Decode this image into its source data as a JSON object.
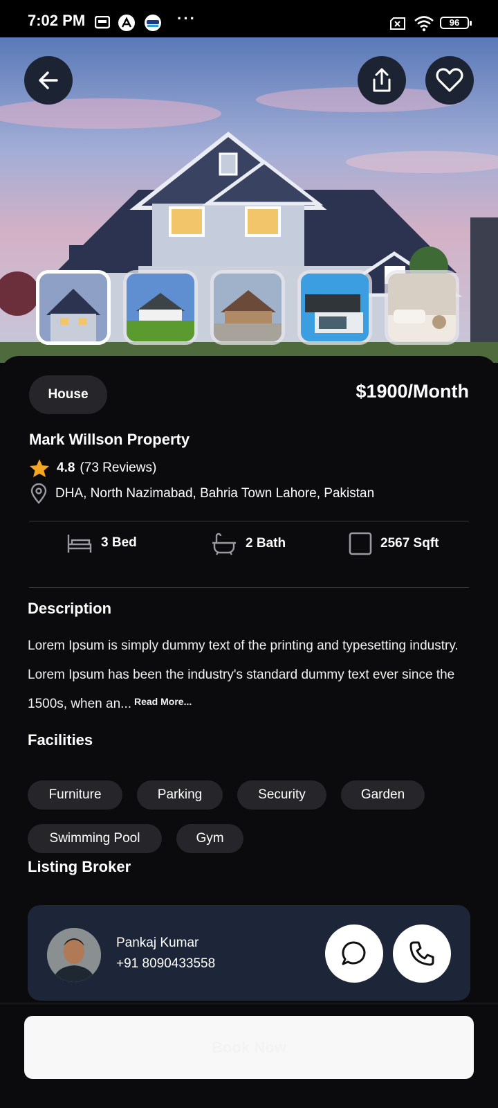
{
  "status_bar": {
    "time": "7:02 PM",
    "battery": "96",
    "icons": [
      "notification-icon",
      "app-icon",
      "cricket-icon",
      "more-dots",
      "sim-icon",
      "wifi-icon",
      "battery-icon"
    ]
  },
  "hero": {
    "actions": [
      "back-arrow-icon",
      "share-icon",
      "heart-icon"
    ],
    "thumbnails": [
      {
        "name": "thumb-house-evening",
        "active": true
      },
      {
        "name": "thumb-house-lawn",
        "active": false
      },
      {
        "name": "thumb-house-stone",
        "active": false
      },
      {
        "name": "thumb-modern-house",
        "active": false
      },
      {
        "name": "thumb-interior",
        "active": false
      }
    ]
  },
  "property": {
    "type": "House",
    "price": "$1900/Month",
    "title": "Mark Willson Property",
    "rating": "4.8",
    "reviews": "(73 Reviews)",
    "location": "DHA, North Nazimabad, Bahria Town Lahore, Pakistan"
  },
  "specs": {
    "beds": "3 Bed",
    "baths": "2 Bath",
    "area": "2567 Sqft"
  },
  "description": {
    "title": "Description",
    "text": "Lorem Ipsum is simply dummy text of the printing and typesetting industry. Lorem Ipsum has been the industry's standard dummy text ever since the 1500s, when an...",
    "read_more": "Read More..."
  },
  "facilities": {
    "title": "Facilities",
    "items": [
      "Furniture",
      "Parking",
      "Security",
      "Garden",
      "Swimming Pool",
      "Gym"
    ]
  },
  "broker": {
    "section_title": "Listing Broker",
    "name": "Pankaj Kumar",
    "phone": "+91 8090433558"
  },
  "cta": {
    "book_label": "Book Now"
  },
  "colors": {
    "background": "#0a0a0c",
    "chip": "#26262a",
    "broker_card": "#1c2638",
    "star": "#f5a623",
    "button": "#f8f8f8"
  }
}
